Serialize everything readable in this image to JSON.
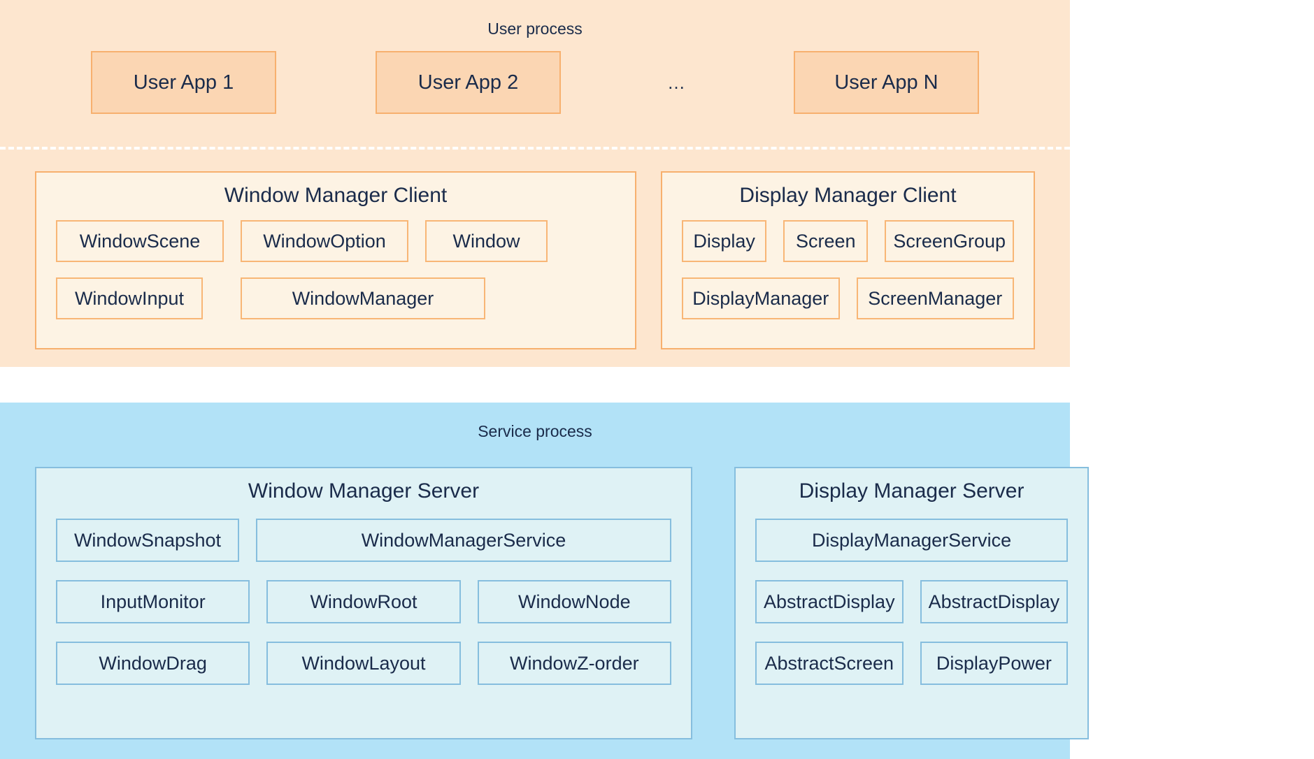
{
  "user": {
    "title": "User process",
    "apps": [
      "User App 1",
      "User App 2",
      "User App N"
    ],
    "ellipsis": "…",
    "window_client": {
      "title": "Window Manager Client",
      "row1": [
        "WindowScene",
        "WindowOption",
        "Window"
      ],
      "row2": [
        "WindowInput",
        "WindowManager"
      ]
    },
    "display_client": {
      "title": "Display Manager Client",
      "row1": [
        "Display",
        "Screen",
        "ScreenGroup"
      ],
      "row2": [
        "DisplayManager",
        "ScreenManager"
      ]
    }
  },
  "service": {
    "title": "Service process",
    "window_server": {
      "title": "Window Manager Server",
      "row1": [
        "WindowSnapshot",
        "WindowManagerService"
      ],
      "row2": [
        "InputMonitor",
        "WindowRoot",
        "WindowNode"
      ],
      "row3": [
        "WindowDrag",
        "WindowLayout",
        "WindowZ-order"
      ]
    },
    "display_server": {
      "title": "Display Manager Server",
      "row1": [
        "DisplayManagerService"
      ],
      "row2": [
        "AbstractDisplay",
        "AbstractDisplay"
      ],
      "row3": [
        "AbstractScreen",
        "DisplayPower"
      ]
    }
  }
}
